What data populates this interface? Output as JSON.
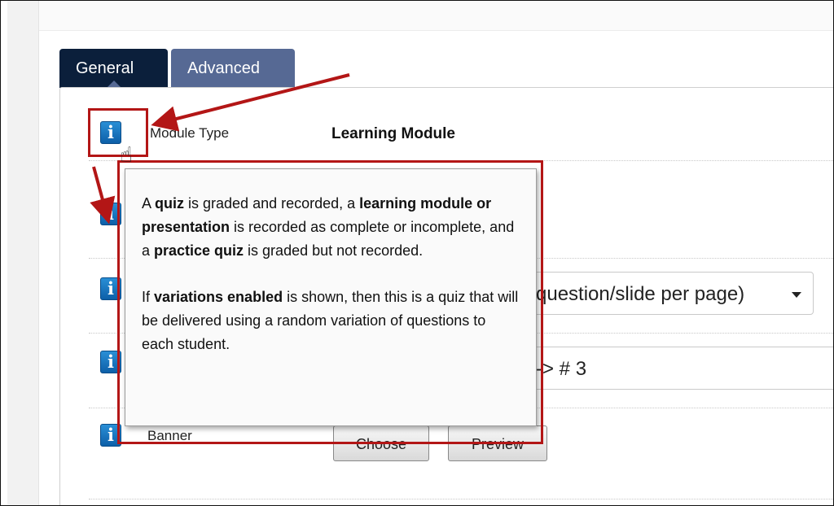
{
  "tabs": [
    {
      "label": "General",
      "active": true
    },
    {
      "label": "Advanced",
      "active": false
    }
  ],
  "fields": {
    "module_type": {
      "label": "Module Type",
      "value": "Learning Module"
    },
    "display": {
      "selected_partial": "question/slide per page)"
    },
    "mapping": {
      "value_partial": "-> # 3"
    },
    "banner": {
      "label": "Banner",
      "choose_label": "Choose",
      "preview_label": "Preview"
    }
  },
  "tooltip": {
    "p1": [
      {
        "text": "A ",
        "bold": false
      },
      {
        "text": "quiz",
        "bold": true
      },
      {
        "text": " is graded and recorded, a ",
        "bold": false
      },
      {
        "text": "learning module or presentation",
        "bold": true
      },
      {
        "text": " is recorded as complete or incomplete, and a ",
        "bold": false
      },
      {
        "text": "practice quiz",
        "bold": true
      },
      {
        "text": " is graded but not recorded.",
        "bold": false
      }
    ],
    "p2": [
      {
        "text": "If ",
        "bold": false
      },
      {
        "text": "variations enabled",
        "bold": true
      },
      {
        "text": " is shown, then this is a quiz that will be delivered using a random variation of questions to each student.",
        "bold": false
      }
    ]
  },
  "icons": {
    "info_glyph": "i",
    "pointer_glyph": "☝"
  },
  "colors": {
    "annotation_red": "#b31616",
    "tab_active": "#0b1f3b",
    "tab_inactive": "#566994",
    "info_blue": "#1c76c4"
  }
}
